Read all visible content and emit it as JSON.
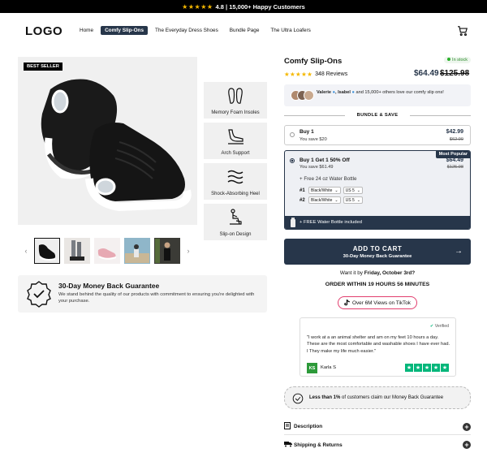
{
  "announcement": {
    "stars": "★★★★★",
    "text": "4.8 | 15,000+ Happy Customers"
  },
  "header": {
    "logo": "LOGO",
    "nav": [
      "Home",
      "Comfy Slip-Ons",
      "The Everyday Dress Shoes",
      "Bundle Page",
      "The Ultra Loafers"
    ],
    "active_nav": "Comfy Slip-Ons"
  },
  "gallery": {
    "badge": "BEST SELLER",
    "features": [
      "Memory Foam Insoles",
      "Arch Support",
      "Shock-Absorbing Heel",
      "Slip-on Design"
    ],
    "prev_arrow": "‹",
    "next_arrow": "›"
  },
  "guarantee": {
    "title": "30-Day Money Back Guarantee",
    "text": "We stand behind the quality of our products with commitment to ensuring you're delighted with your purchase."
  },
  "product": {
    "title": "Comfy Slip-Ons",
    "stock": "In stock",
    "stars": "★★★★★",
    "reviews": "348 Reviews",
    "price": "$64.49",
    "compare_price": "$125.98"
  },
  "social_proof": {
    "name1": "Valerie",
    "name2": ", Isabel",
    "text": "and 15,000+ others love our comfy slip ons!"
  },
  "bundle": {
    "heading": "BUNDLE & SAVE",
    "option1": {
      "title": "Buy 1",
      "save": "You save $20",
      "price": "$42.99",
      "was": "$62.99"
    },
    "option2": {
      "badge": "Most Popular",
      "title": "Buy 1 Get 1 50% Off",
      "save": "You save $61.49",
      "price": "$64.49",
      "was": "$125.98",
      "gift": "+  Free 24 oz Water Bottle",
      "rows": [
        {
          "num": "#1",
          "color": "Black/White",
          "size": "US 5"
        },
        {
          "num": "#2",
          "color": "Black/White",
          "size": "US 5"
        }
      ],
      "free_bar": "+ FREE Water Bottle included"
    }
  },
  "cta": {
    "label": "ADD TO CART",
    "sub": "30-Day Money Back Guarantee",
    "arrow": "→"
  },
  "delivery": {
    "want_prefix": "Want it by",
    "date": "Friday, October 3rd?",
    "order_text": "ORDER WITHIN 19 HOURS 56 MINUTES"
  },
  "tiktok": {
    "label": "Over 6M Views on TikTok"
  },
  "review": {
    "verified": "Verified",
    "text": "\"I work at a an animal shelter and am on my feet 10 hours a day. These are the most comfortable and washable shoes I have ever had. I They make my life much easier.\"",
    "initials": "KS",
    "name": "Karla S"
  },
  "claim": {
    "bold": "Less than 1%",
    "text": " of customers claim our Money Back Guarantee"
  },
  "accordion": [
    "Description",
    "Shipping & Returns"
  ],
  "colors": {
    "brand": "#27364a",
    "star": "#f5b800",
    "trustpilot": "#00b67a",
    "tiktok_border": "#e23e6e"
  }
}
